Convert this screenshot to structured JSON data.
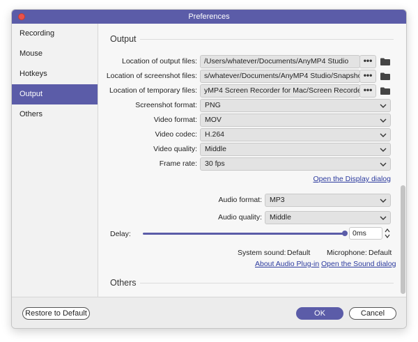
{
  "window": {
    "title": "Preferences"
  },
  "sidebar": {
    "items": [
      {
        "label": "Recording"
      },
      {
        "label": "Mouse"
      },
      {
        "label": "Hotkeys"
      },
      {
        "label": "Output"
      },
      {
        "label": "Others"
      }
    ],
    "active": "Output"
  },
  "output": {
    "title": "Output",
    "output_files_label": "Location of output files:",
    "output_files_value": "/Users/whatever/Documents/AnyMP4 Studio",
    "screenshot_files_label": "Location of screenshot files:",
    "screenshot_files_value": "s/whatever/Documents/AnyMP4 Studio/Snapshot",
    "temp_files_label": "Location of temporary files:",
    "temp_files_value": "yMP4 Screen Recorder for Mac/Screen Recorder",
    "browse_label": "•••",
    "screenshot_format_label": "Screenshot format:",
    "screenshot_format_value": "PNG",
    "video_format_label": "Video format:",
    "video_format_value": "MOV",
    "video_codec_label": "Video codec:",
    "video_codec_value": "H.264",
    "video_quality_label": "Video quality:",
    "video_quality_value": "Middle",
    "frame_rate_label": "Frame rate:",
    "frame_rate_value": "30 fps",
    "display_dialog_link": "Open the Display dialog",
    "audio_format_label": "Audio format:",
    "audio_format_value": "MP3",
    "audio_quality_label": "Audio quality:",
    "audio_quality_value": "Middle",
    "delay_label": "Delay:",
    "delay_value": "0ms",
    "system_sound_label": "System sound:",
    "system_sound_value": "Default",
    "microphone_label": "Microphone:",
    "microphone_value": "Default",
    "audio_plugin_link": "About Audio Plug-in",
    "sound_dialog_link": "Open the Sound dialog"
  },
  "others": {
    "title": "Others"
  },
  "footer": {
    "restore_label": "Restore to Default",
    "ok_label": "OK",
    "cancel_label": "Cancel"
  },
  "colors": {
    "accent": "#5b5ca8",
    "link": "#2b3a9e",
    "close": "#e9524a"
  }
}
